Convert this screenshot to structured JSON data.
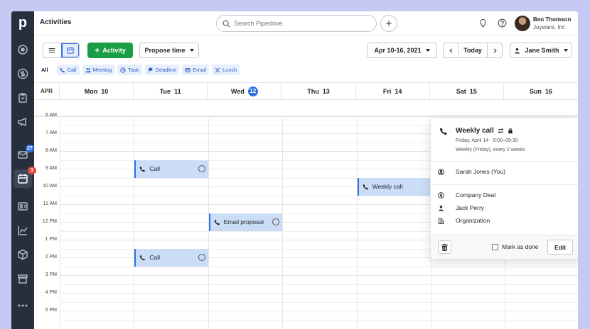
{
  "app": {
    "logo_letter": "p",
    "title": "Activities"
  },
  "colors": {
    "sidebar": "#26303c",
    "accent": "#2f6fe4",
    "primary_button": "#1a9e45",
    "event_fill": "#cbdcf7",
    "page_bg": "#c7c8f4"
  },
  "sidebar": {
    "items": [
      {
        "icon": "target-icon"
      },
      {
        "icon": "dollar-icon"
      },
      {
        "icon": "clipboard-icon"
      },
      {
        "icon": "megaphone-icon"
      },
      {
        "icon": "mail-icon",
        "badge": "27"
      },
      {
        "icon": "calendar-icon",
        "badge": "3",
        "active": true
      },
      {
        "icon": "contacts-icon"
      },
      {
        "icon": "chart-icon"
      },
      {
        "icon": "box-icon"
      },
      {
        "icon": "store-icon"
      },
      {
        "icon": "more-icon"
      }
    ]
  },
  "header": {
    "search_placeholder": "Search Pipedrive",
    "user_name": "Ben Thomson",
    "user_company": "Joyware, Inc"
  },
  "toolbar": {
    "activity_button": "Activity",
    "propose_time": "Propose time",
    "date_range": "Apr 10-16, 2021",
    "today": "Today",
    "owner": "Jane Smith"
  },
  "filters": {
    "all": "All",
    "types": [
      "Call",
      "Meeting",
      "Task",
      "Deadline",
      "Email",
      "Lunch"
    ]
  },
  "calendar": {
    "month": "APR",
    "days": [
      {
        "name": "Mon",
        "num": "10"
      },
      {
        "name": "Tue",
        "num": "11"
      },
      {
        "name": "Wed",
        "num": "12",
        "today": true
      },
      {
        "name": "Thu",
        "num": "13"
      },
      {
        "name": "Fri",
        "num": "14"
      },
      {
        "name": "Sat",
        "num": "15"
      },
      {
        "name": "Sun",
        "num": "16"
      }
    ],
    "times": [
      "6 AM",
      "7 AM",
      "8 AM",
      "9 AM",
      "10 AM",
      "11 AM",
      "12 PM",
      "1 PM",
      "2 PM",
      "3 PM",
      "4 PM",
      "5 PM"
    ],
    "events": [
      {
        "label": "Call",
        "day": 1,
        "start_hour": 8.5
      },
      {
        "label": "Email proposal",
        "day": 2,
        "start_hour": 11.5
      },
      {
        "label": "Call",
        "day": 1,
        "start_hour": 13.5
      },
      {
        "label": "Weekly call",
        "day": 4,
        "start_hour": 9.5
      }
    ]
  },
  "popup": {
    "title": "Weekly call",
    "when": "Friday, April 14 · 9:00–09:30",
    "recurrence": "Weekly (Friday), every 2 weeks",
    "attendee": "Sarah Jones (You)",
    "deal": "Company Deal",
    "person": "Jack Perry",
    "organization": "Organization",
    "mark_done": "Mark as done",
    "edit": "Edit"
  }
}
